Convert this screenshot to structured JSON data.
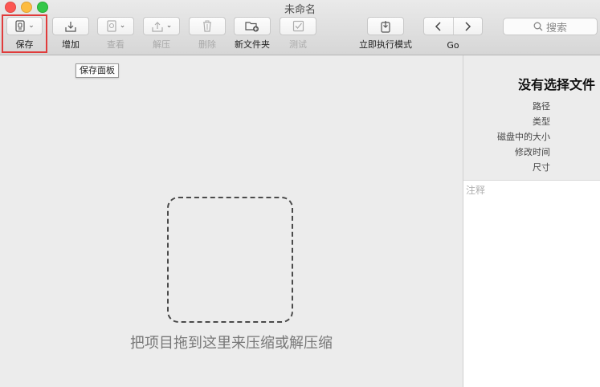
{
  "window": {
    "title": "未命名"
  },
  "toolbar": {
    "save": {
      "label": "保存",
      "icon": "archive-save-icon"
    },
    "add": {
      "label": "增加",
      "icon": "add-tray-icon"
    },
    "view": {
      "label": "查看",
      "icon": "quicklook-icon"
    },
    "extract": {
      "label": "解压",
      "icon": "extract-tray-icon"
    },
    "delete": {
      "label": "删除",
      "icon": "trash-icon"
    },
    "new_folder": {
      "label": "新文件夹",
      "icon": "new-folder-icon"
    },
    "test": {
      "label": "测试",
      "icon": "checkbox-icon"
    },
    "immediate_mode": {
      "label": "立即执行模式",
      "icon": "immediate-mode-icon"
    },
    "go": {
      "label": "Go"
    },
    "search": {
      "placeholder": "搜索"
    }
  },
  "tooltip": {
    "text": "保存面板"
  },
  "drop_area": {
    "text": "把项目拖到这里来压缩或解压缩"
  },
  "inspector": {
    "title": "没有选择文件",
    "properties": [
      "路径",
      "类型",
      "磁盘中的大小",
      "修改时间",
      "尺寸"
    ],
    "notes_placeholder": "注释"
  },
  "colors": {
    "highlight": "#e03b3b",
    "close": "#fc5753",
    "minimize": "#fdbc40",
    "zoom": "#33c748"
  }
}
